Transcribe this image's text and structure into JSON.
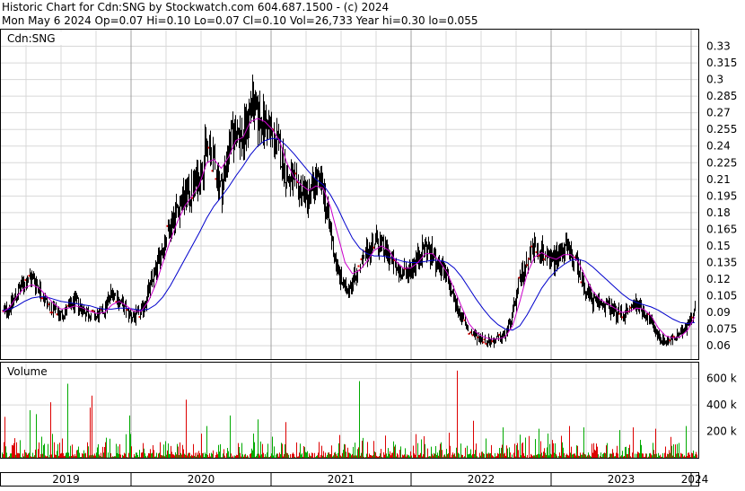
{
  "header": {
    "line1": "Historic Chart for Cdn:SNG by Stockwatch.com 604.687.1500 - (c) 2024",
    "line2": "Mon May  6 2024  Op=0.07  Hi=0.10  Lo=0.07  Cl=0.10  Vol=26,733  Year hi=0.30  lo=0.055"
  },
  "chart_data": [
    {
      "type": "candlestick-line",
      "title": "Cdn:SNG",
      "y_ticks": [
        "0.33",
        "0.315",
        "0.3",
        "0.285",
        "0.27",
        "0.255",
        "0.24",
        "0.225",
        "0.21",
        "0.195",
        "0.18",
        "0.165",
        "0.15",
        "0.135",
        "0.12",
        "0.105",
        "0.09",
        "0.075",
        "0.06"
      ],
      "ylim": [
        0.048,
        0.345
      ],
      "x_labels": [
        "2019",
        "2020",
        "2021",
        "2022",
        "2023",
        "2024"
      ],
      "grid": true,
      "colors": {
        "price": "#000000",
        "ma_short": "#cc00cc",
        "ma_long": "#0000cc",
        "down_mark": "#dd0000"
      },
      "series": [
        {
          "values": [
            0.09,
            0.096,
            0.108,
            0.118,
            0.122,
            0.112,
            0.098,
            0.092,
            0.088,
            0.094,
            0.1,
            0.092,
            0.088,
            0.086,
            0.094,
            0.11,
            0.1,
            0.09,
            0.086,
            0.09,
            0.11,
            0.13,
            0.15,
            0.17,
            0.185,
            0.195,
            0.2,
            0.215,
            0.24,
            0.225,
            0.2,
            0.24,
            0.255,
            0.245,
            0.28,
            0.265,
            0.26,
            0.25,
            0.235,
            0.21,
            0.205,
            0.2,
            0.195,
            0.21,
            0.2,
            0.16,
            0.125,
            0.11,
            0.12,
            0.13,
            0.145,
            0.155,
            0.15,
            0.14,
            0.128,
            0.125,
            0.13,
            0.14,
            0.15,
            0.14,
            0.13,
            0.12,
            0.1,
            0.085,
            0.072,
            0.068,
            0.066,
            0.064,
            0.066,
            0.07,
            0.09,
            0.12,
            0.14,
            0.15,
            0.145,
            0.135,
            0.14,
            0.15,
            0.14,
            0.13,
            0.11,
            0.1,
            0.098,
            0.096,
            0.09,
            0.088,
            0.092,
            0.1,
            0.09,
            0.08,
            0.068,
            0.064,
            0.066,
            0.07,
            0.08,
            0.095
          ]
        },
        {
          "name": "",
          "values": [
            0.09,
            0.095,
            0.105,
            0.112,
            0.115,
            0.112,
            0.105,
            0.098,
            0.093,
            0.094,
            0.096,
            0.094,
            0.091,
            0.089,
            0.09,
            0.097,
            0.1,
            0.096,
            0.091,
            0.091,
            0.1,
            0.115,
            0.135,
            0.155,
            0.172,
            0.186,
            0.195,
            0.205,
            0.225,
            0.228,
            0.22,
            0.23,
            0.245,
            0.248,
            0.262,
            0.265,
            0.262,
            0.255,
            0.245,
            0.225,
            0.212,
            0.205,
            0.2,
            0.204,
            0.202,
            0.185,
            0.16,
            0.135,
            0.125,
            0.128,
            0.136,
            0.146,
            0.15,
            0.146,
            0.136,
            0.13,
            0.13,
            0.135,
            0.143,
            0.143,
            0.136,
            0.126,
            0.111,
            0.095,
            0.08,
            0.072,
            0.068,
            0.066,
            0.066,
            0.068,
            0.078,
            0.1,
            0.125,
            0.14,
            0.144,
            0.14,
            0.138,
            0.142,
            0.142,
            0.136,
            0.122,
            0.109,
            0.102,
            0.098,
            0.094,
            0.09,
            0.091,
            0.094,
            0.093,
            0.087,
            0.076,
            0.069,
            0.067,
            0.068,
            0.074,
            0.086
          ]
        },
        {
          "name": "",
          "values": [
            0.092,
            0.093,
            0.096,
            0.1,
            0.103,
            0.104,
            0.104,
            0.102,
            0.1,
            0.099,
            0.098,
            0.097,
            0.096,
            0.094,
            0.093,
            0.093,
            0.094,
            0.094,
            0.093,
            0.092,
            0.093,
            0.097,
            0.104,
            0.114,
            0.126,
            0.138,
            0.15,
            0.162,
            0.175,
            0.186,
            0.194,
            0.203,
            0.213,
            0.222,
            0.232,
            0.24,
            0.245,
            0.247,
            0.246,
            0.24,
            0.233,
            0.225,
            0.217,
            0.21,
            0.205,
            0.196,
            0.184,
            0.17,
            0.157,
            0.148,
            0.143,
            0.141,
            0.141,
            0.14,
            0.138,
            0.136,
            0.135,
            0.135,
            0.136,
            0.137,
            0.137,
            0.135,
            0.13,
            0.122,
            0.112,
            0.102,
            0.093,
            0.085,
            0.079,
            0.075,
            0.074,
            0.078,
            0.088,
            0.1,
            0.112,
            0.121,
            0.128,
            0.133,
            0.137,
            0.138,
            0.136,
            0.131,
            0.125,
            0.119,
            0.113,
            0.107,
            0.102,
            0.099,
            0.097,
            0.095,
            0.092,
            0.088,
            0.084,
            0.081,
            0.08,
            0.081
          ]
        }
      ]
    },
    {
      "type": "bar",
      "title": "Volume",
      "y_ticks": [
        "600 k",
        "400 k",
        "200 k"
      ],
      "ylim": [
        0,
        720000
      ],
      "colors": {
        "up": "#00aa00",
        "down": "#dd0000"
      },
      "peaks": [
        {
          "index": 5,
          "value": 310000,
          "color": "down"
        },
        {
          "index": 33,
          "value": 360000,
          "color": "up"
        },
        {
          "index": 40,
          "value": 330000,
          "color": "up"
        },
        {
          "index": 56,
          "value": 420000,
          "color": "down"
        },
        {
          "index": 75,
          "value": 560000,
          "color": "up"
        },
        {
          "index": 100,
          "value": 380000,
          "color": "down"
        },
        {
          "index": 102,
          "value": 470000,
          "color": "down"
        },
        {
          "index": 144,
          "value": 320000,
          "color": "up"
        },
        {
          "index": 207,
          "value": 440000,
          "color": "down"
        },
        {
          "index": 230,
          "value": 240000,
          "color": "up"
        },
        {
          "index": 256,
          "value": 320000,
          "color": "up"
        },
        {
          "index": 287,
          "value": 290000,
          "color": "up"
        },
        {
          "index": 318,
          "value": 270000,
          "color": "down"
        },
        {
          "index": 400,
          "value": 580000,
          "color": "up"
        },
        {
          "index": 500,
          "value": 190000,
          "color": "down"
        },
        {
          "index": 509,
          "value": 660000,
          "color": "down"
        },
        {
          "index": 527,
          "value": 280000,
          "color": "down"
        },
        {
          "index": 560,
          "value": 230000,
          "color": "up"
        },
        {
          "index": 600,
          "value": 220000,
          "color": "up"
        },
        {
          "index": 634,
          "value": 240000,
          "color": "down"
        },
        {
          "index": 650,
          "value": 230000,
          "color": "up"
        },
        {
          "index": 690,
          "value": 210000,
          "color": "up"
        },
        {
          "index": 705,
          "value": 230000,
          "color": "down"
        },
        {
          "index": 730,
          "value": 220000,
          "color": "down"
        },
        {
          "index": 764,
          "value": 240000,
          "color": "up"
        }
      ]
    }
  ]
}
